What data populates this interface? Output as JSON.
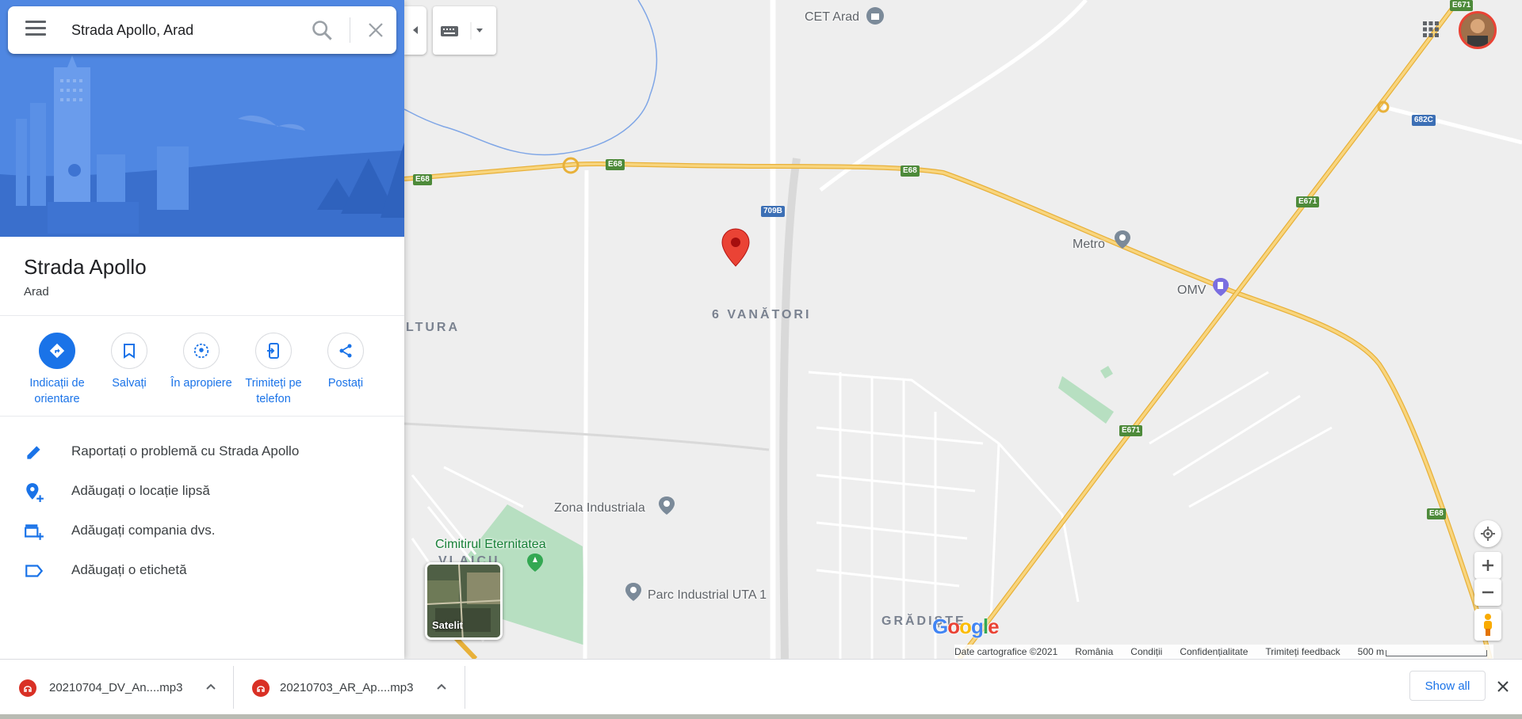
{
  "search": {
    "value": "Strada Apollo, Arad",
    "menu_icon": "hamburger-menu-icon",
    "search_icon": "search-icon",
    "close_icon": "close-icon"
  },
  "place": {
    "title": "Strada Apollo",
    "subtitle": "Arad"
  },
  "actions": [
    {
      "label": "Indicații de orientare",
      "icon": "directions-icon"
    },
    {
      "label": "Salvați",
      "icon": "bookmark-icon"
    },
    {
      "label": "În apropiere",
      "icon": "nearby-icon"
    },
    {
      "label": "Trimiteți pe telefon",
      "icon": "send-to-phone-icon"
    },
    {
      "label": "Postați",
      "icon": "share-icon"
    }
  ],
  "rows": [
    {
      "label": "Raportați o problemă cu Strada Apollo",
      "icon": "edit-pencil-icon"
    },
    {
      "label": "Adăugați o locație lipsă",
      "icon": "add-location-icon"
    },
    {
      "label": "Adăugați compania dvs.",
      "icon": "add-business-icon"
    },
    {
      "label": "Adăugați o etichetă",
      "icon": "label-tag-icon"
    }
  ],
  "map": {
    "labels": {
      "cet_arad": "CET Arad",
      "metro": "Metro",
      "omv": "OMV",
      "zona_industriala": "Zona Industriala",
      "cimitirul": "Cimitirul Eternitatea",
      "parc_industrial": "Parc Industrial UTA 1"
    },
    "districts": {
      "vanatori": "6 VANĂTORI",
      "ltura": "LTURA",
      "vlaicu": "VLAICU",
      "gradiste": "GRĂDIȘTE"
    },
    "roads": {
      "e68": "E68",
      "e671": "E671",
      "r709b": "709B",
      "r682c": "682C"
    },
    "satellite_label": "Satelit",
    "logo": "Google"
  },
  "footer": {
    "data": "Date cartografice ©2021",
    "country": "România",
    "terms": "Condiții",
    "privacy": "Confidențialitate",
    "feedback": "Trimiteți feedback",
    "scale": "500 m"
  },
  "downloads": {
    "items": [
      {
        "name": "20210704_DV_An....mp3"
      },
      {
        "name": "20210703_AR_Ap....mp3"
      }
    ],
    "show_all": "Show all"
  },
  "colors": {
    "accent": "#1a73e8",
    "pin": "#ea4335",
    "highway": "#f6c343",
    "park": "#b7dfc1"
  }
}
